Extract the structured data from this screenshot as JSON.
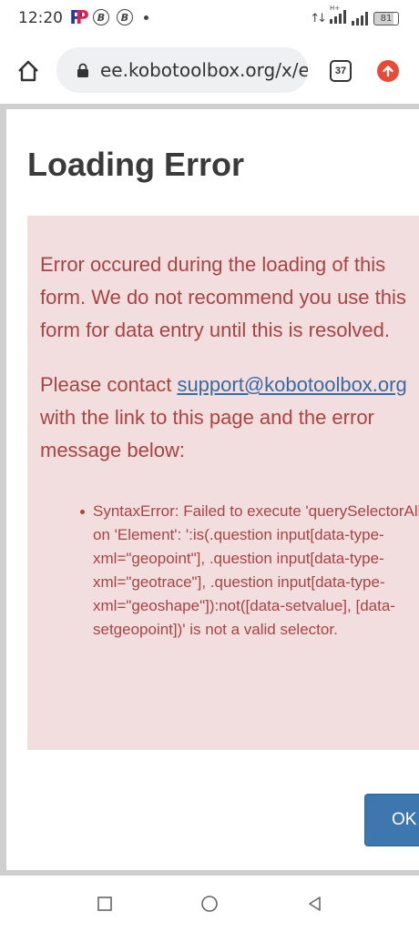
{
  "status_bar": {
    "time": "12:20",
    "battery": "81",
    "network_label": "H+",
    "icons": [
      "picsart-p-icon",
      "b-coin-icon",
      "b-coin-icon",
      "dot-icon",
      "data-arrows-icon",
      "signal-icon",
      "signal-icon",
      "battery-icon"
    ]
  },
  "browser": {
    "url": "ee.kobotoolbox.org/x/e",
    "tab_count": "37",
    "colors": {
      "update": "#e94a35",
      "url_bar": "#eef0f1"
    }
  },
  "dialog": {
    "title": "Loading Error",
    "message": "Error occured during the loading of this form. We do not recommend you use this form for data entry until this is resolved.",
    "contact_prefix": "Please contact ",
    "support_email": "support@kobotoolbox.org",
    "contact_suffix": " with the link to this page and the error message below:",
    "errors": [
      "SyntaxError: Failed to execute 'querySelectorAll' on 'Element': ':is(.question input[data-type-xml=\"geopoint\"], .question input[data-type-xml=\"geotrace\"], .question input[data-type-xml=\"geoshape\"]):not([data-setvalue], [data-setgeopoint])' is not a valid selector."
    ],
    "ok_label": "OK",
    "colors": {
      "alert_bg": "#f2dede",
      "alert_text": "#a94442",
      "link": "#3b6aa1",
      "button": "#3d77ad"
    }
  },
  "nav": {
    "buttons": [
      "recents-icon",
      "home-circle-icon",
      "back-triangle-icon"
    ]
  }
}
